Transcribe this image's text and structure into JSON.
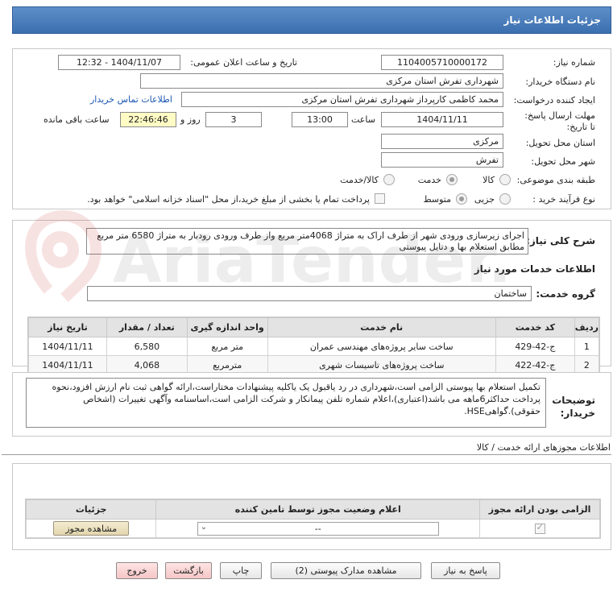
{
  "title": "جزئیات اطلاعات نیاز",
  "labels": {
    "need_number": "شماره نیاز:",
    "announce_datetime": "تاریخ و ساعت اعلان عمومی:",
    "buyer_org": "نام دستگاه خریدار:",
    "requester": "ایجاد کننده درخواست:",
    "contact_link": "اطلاعات تماس خریدار",
    "deadline": "مهلت ارسال پاسخ: تا تاریخ:",
    "time": "ساعت",
    "day_and": "روز و",
    "remaining": "ساعت باقی مانده",
    "province": "استان محل تحویل:",
    "city": "شهر محل تحویل:",
    "category": "طبقه بندی موضوعی:",
    "process_type": "نوع فرآیند خرید :",
    "general_desc": "شرح کلی نیاز:",
    "services_info": "اطلاعات خدمات مورد نیاز",
    "service_group": "گروه خدمت:",
    "buyer_notes": "توضیحات خریدار:",
    "permits_title": "اطلاعات مجوزهای ارائه خدمت / کالا"
  },
  "values": {
    "need_number": "1104005710000172",
    "announce_datetime": "1404/11/07 - 12:32",
    "buyer_org": "شهرداری تفرش استان مرکزی",
    "requester": "محمد کاظمی کارپرداز شهرداری تفرش استان مرکزی",
    "deadline_date": "1404/11/11",
    "deadline_time": "13:00",
    "days": "3",
    "remaining": "22:46:46",
    "province": "مرکزی",
    "city": "تفرش",
    "general_desc": "اجرای زیرسازی ورودی شهر از طرف اراک به متراژ 4068متر مربع  واز طرف ورودی رودبار به متراژ 6580 متر مربع مطابق استعلام بها و دتایل پیوستی",
    "service_group": "ساختمان",
    "buyer_notes": "تکمیل استعلام بها پیوستی الزامی است،شهرداری در رد یاقبول یک یاکلیه پیشنهادات مختاراست،ارائه گواهی ثبت نام ارزش افزود،نحوه پرداخت حداکثر6ماهه می باشد(اعتباری)،اعلام شماره تلفن پیمانکار و شرکت الزامی است،اساسنامه وآگهی تغییرات (اشخاص حقوقی).گواهیHSE."
  },
  "category_options": [
    {
      "label": "کالا",
      "selected": false
    },
    {
      "label": "خدمت",
      "selected": true
    },
    {
      "label": "کالا/خدمت",
      "selected": false
    }
  ],
  "process_options": [
    {
      "label": "جزیی",
      "selected": false
    },
    {
      "label": "متوسط",
      "selected": true
    }
  ],
  "treasury_note": "پرداخت تمام یا بخشی از مبلغ خرید،از محل \"اسناد خزانه اسلامی\" خواهد بود.",
  "services_table": {
    "headers": [
      "ردیف",
      "کد خدمت",
      "نام خدمت",
      "واحد اندازه گیری",
      "تعداد / مقدار",
      "تاریخ نیاز"
    ],
    "rows": [
      [
        "1",
        "ج-42-429",
        "ساخت سایر پروژه‌های مهندسی عمران",
        "متر مربع",
        "6,580",
        "1404/11/11"
      ],
      [
        "2",
        "ج-42-422",
        "ساخت پروژه‌های تاسیسات شهری",
        "مترمربع",
        "4,068",
        "1404/11/11"
      ]
    ]
  },
  "permits_table": {
    "headers": [
      "الزامی بودن ارائه مجوز",
      "اعلام وضعیت مجوز توسط تامین کننده",
      "جزئیات"
    ],
    "select_value": "--",
    "view_button": "مشاهده مجوز"
  },
  "buttons": {
    "reply": "پاسخ به نیاز",
    "attachments": "مشاهده مدارک پیوستی (2)",
    "print": "چاپ",
    "back": "بازگشت",
    "exit": "خروج"
  },
  "watermark": "AriaTender.neT",
  "colors": {
    "title_bar": "#4a7fbd",
    "highlight": "#fffbc4",
    "link": "#1a56b3"
  }
}
